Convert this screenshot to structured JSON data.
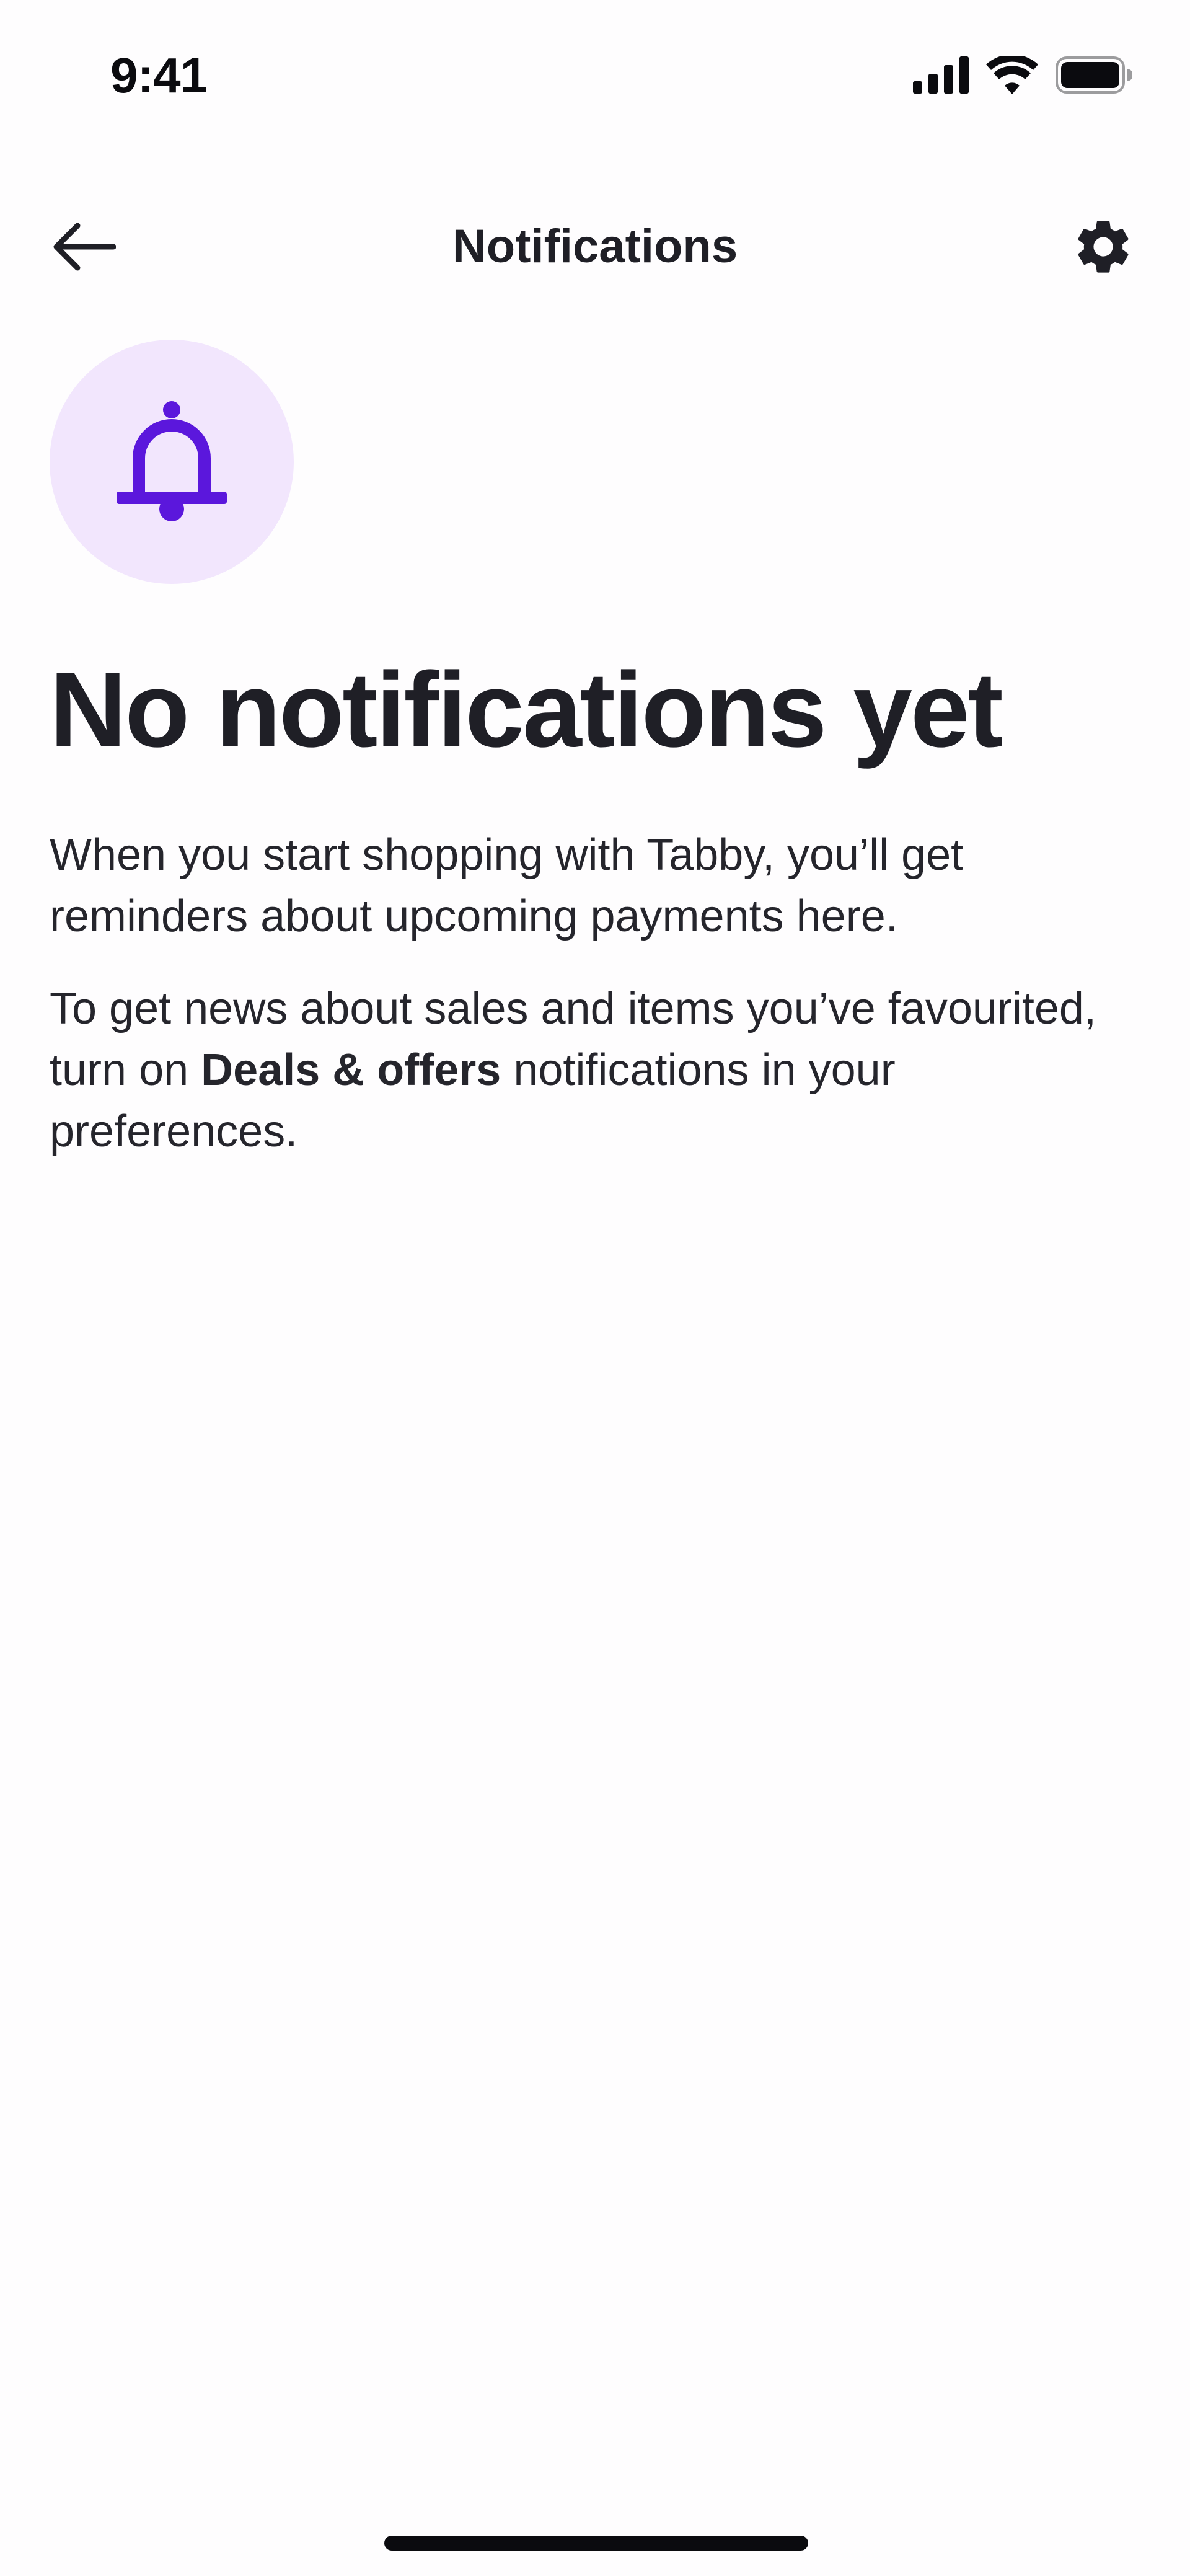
{
  "status_bar": {
    "time": "9:41",
    "icons": [
      "cellular-signal-icon",
      "wifi-icon",
      "battery-icon"
    ]
  },
  "header": {
    "title": "Notifications",
    "back_icon": "arrow-left-icon",
    "settings_icon": "gear-icon"
  },
  "empty_state": {
    "icon": "bell-icon",
    "title": "No notifications yet",
    "paragraph_1": "When you start shopping with Tabby, you’ll get reminders about upcoming payments here.",
    "paragraph_2_before": "To get news about sales and items you’ve favourited, turn on ",
    "paragraph_2_bold": "Deals & offers",
    "paragraph_2_after": " notifications in your preferences."
  },
  "colors": {
    "accent": "#5b17dc",
    "badge_background": "#f2e6fd",
    "text": "#1f1f26",
    "background": "#fefdfe"
  }
}
